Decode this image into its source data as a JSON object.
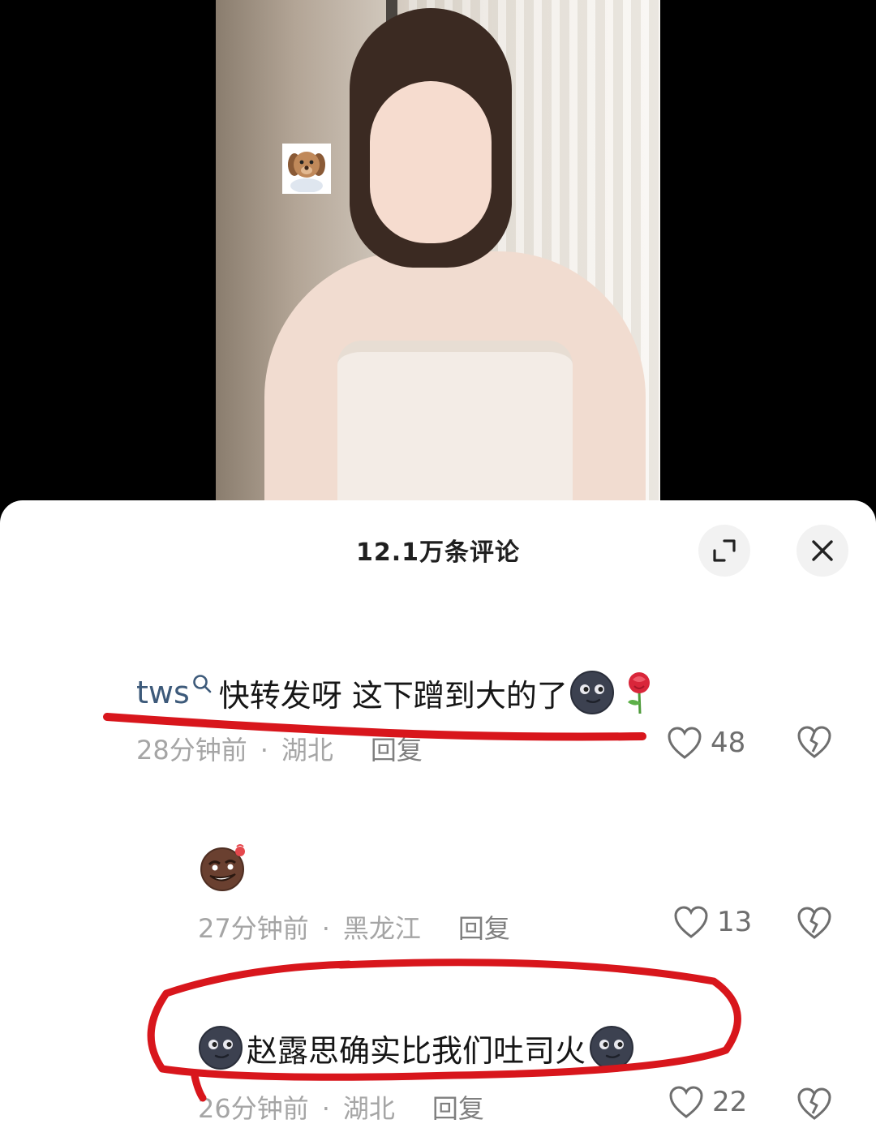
{
  "sheet": {
    "title": "12.1万条评论",
    "expand_icon": "expand-icon",
    "close_icon": "close-icon"
  },
  "comments": [
    {
      "username": "tws",
      "text": "快转发呀 这下蹭到大的了",
      "emojis": [
        "new-moon-face",
        "rose"
      ],
      "time": "28分钟前",
      "location": "湖北",
      "reply": "回复",
      "likes": "48"
    },
    {
      "text": "",
      "emojis": [
        "smirking-cookie-face"
      ],
      "time": "27分钟前",
      "location": "黑龙江",
      "reply": "回复",
      "likes": "13"
    },
    {
      "text": "赵露思确实比我们吐司火",
      "emojis": [
        "new-moon-face",
        "new-moon-face"
      ],
      "time": "26分钟前",
      "location": "湖北",
      "reply": "回复",
      "likes": "22"
    }
  ],
  "separator": "·",
  "colors": {
    "username": "#3d5a7a",
    "meta": "#a5a5a5",
    "annotation": "#d8161c"
  }
}
